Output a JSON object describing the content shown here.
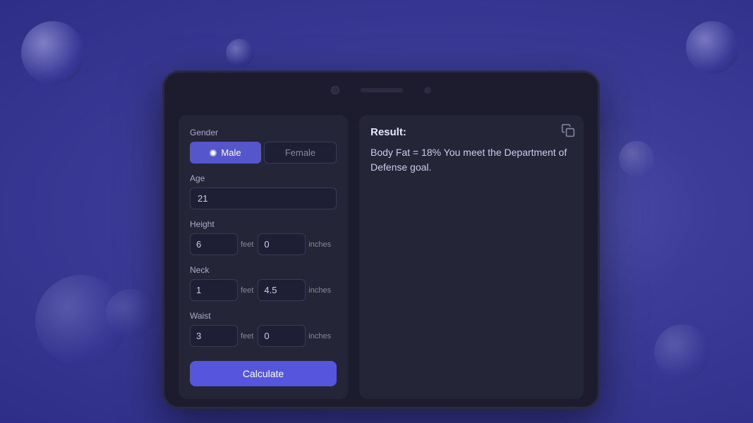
{
  "background": {
    "color": "#4a4aaa"
  },
  "form": {
    "gender_label": "Gender",
    "male_label": "Male",
    "female_label": "Female",
    "age_label": "Age",
    "age_value": "21",
    "height_label": "Height",
    "height_feet": "6",
    "height_inches": "0",
    "neck_label": "Neck",
    "neck_feet": "1",
    "neck_inches": "4.5",
    "waist_label": "Waist",
    "waist_feet": "3",
    "waist_inches": "0",
    "feet_unit": "feet",
    "inches_unit": "inches",
    "calculate_btn": "Calculate"
  },
  "result": {
    "header": "Result:",
    "text": "Body Fat = 18% You meet the Department of Defense goal."
  }
}
